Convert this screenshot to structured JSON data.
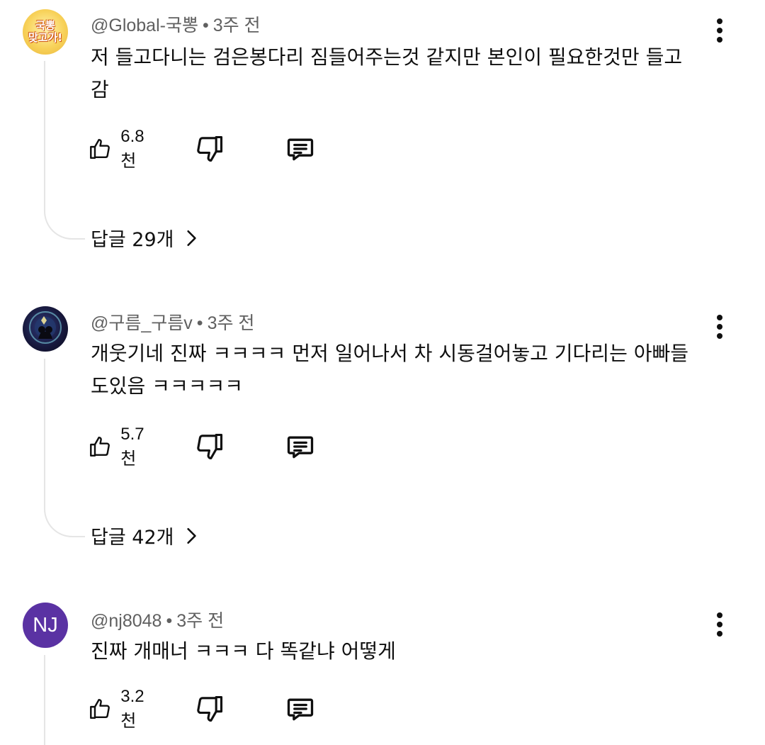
{
  "comments": [
    {
      "author": "@Global-국뽕",
      "time": "3주 전",
      "avatar_text": "국뽕\n맞고가!",
      "text": "저 들고다니는 검은봉다리 짐들어주는것 같지만 본인이 필요한것만 들고감",
      "likes": "6.8천",
      "replies": "답글 29개"
    },
    {
      "author": "@구름_구름v",
      "time": "3주 전",
      "avatar_text": "",
      "text": "개웃기네 진짜 ㅋㅋㅋㅋ 먼저 일어나서 차 시동걸어놓고 기다리는 아빠들도있음 ㅋㅋㅋㅋㅋ",
      "likes": "5.7천",
      "replies": "답글 42개"
    },
    {
      "author": "@nj8048",
      "time": "3주 전",
      "avatar_text": "NJ",
      "text": "진짜 개매너 ㅋㅋㅋ 다 똑같냐 어떻게",
      "likes": "3.2천"
    }
  ],
  "icons": {
    "like": "thumbs-up-icon",
    "dislike": "thumbs-down-icon",
    "reply": "comment-icon",
    "more": "more-vert-icon",
    "chevron": "chevron-right-icon"
  },
  "colors": {
    "meta_text": "#606060",
    "thread_line": "#e5e5e5",
    "nj_avatar": "#5a32a3"
  }
}
